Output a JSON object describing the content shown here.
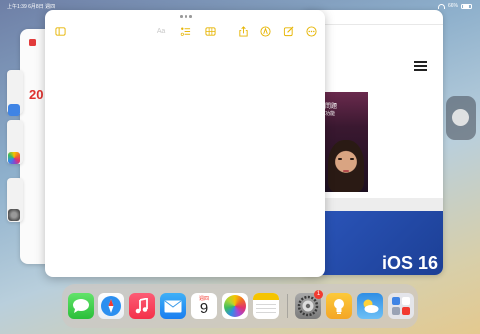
{
  "status_bar": {
    "time": "上午1:39",
    "date": "6月8日 週四",
    "battery": "66%"
  },
  "calendar_window": {
    "year": "20"
  },
  "notes_window": {
    "toolbar": [
      {
        "name": "sidebar-toggle-icon"
      },
      {
        "name": "text-format-icon",
        "label": "Aa"
      },
      {
        "name": "checklist-icon"
      },
      {
        "name": "table-icon"
      },
      {
        "name": "share-icon"
      },
      {
        "name": "markup-icon"
      },
      {
        "name": "compose-icon"
      },
      {
        "name": "more-icon"
      }
    ]
  },
  "safari_window": {
    "banner_title": "問題",
    "banner_subtitle": "功能",
    "headline": "iOS 16"
  },
  "dock": {
    "apps": [
      "Messages",
      "Safari",
      "Music",
      "Mail",
      "Calendar",
      "Photos",
      "Notes",
      "Settings",
      "Tips",
      "Weather",
      "App Library"
    ],
    "calendar_weekday": "週四",
    "calendar_day": "9",
    "settings_badge": "1"
  },
  "colors": {
    "notes_accent": "#e6b400",
    "calendar_red": "#e0312e",
    "ios_blue": "#1c3f95"
  }
}
